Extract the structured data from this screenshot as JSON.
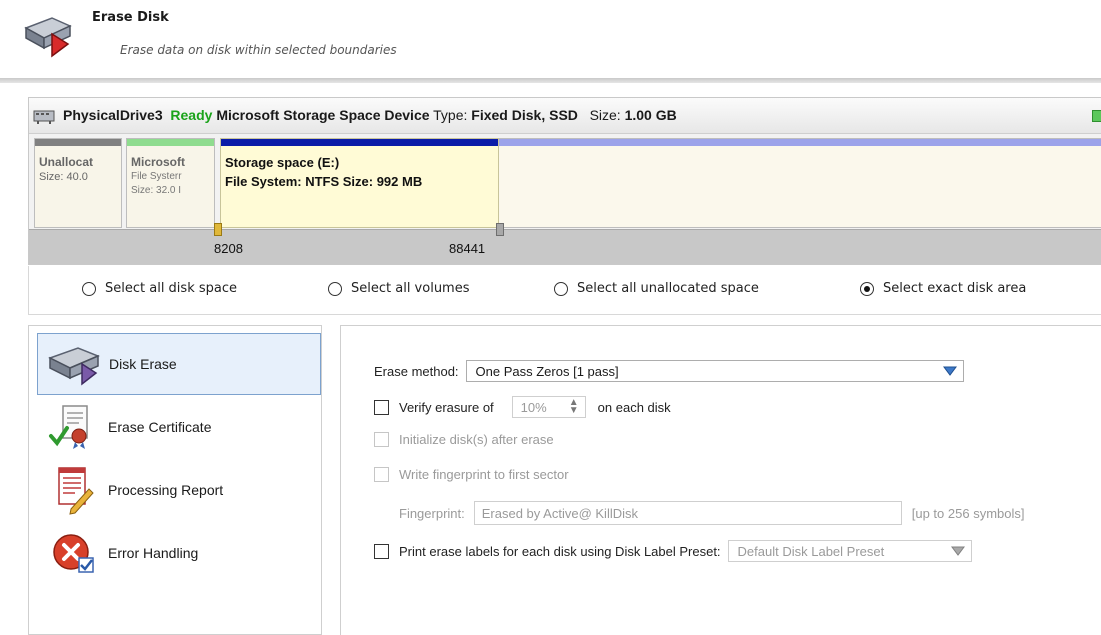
{
  "header": {
    "title": "Erase Disk",
    "subtitle": "Erase data on disk within selected boundaries",
    "icon": "disk-erase-icon"
  },
  "disk": {
    "name": "PhysicalDrive3",
    "status": "Ready",
    "device": "Microsoft Storage Space Device",
    "type_label": "Type:",
    "type_value": "Fixed Disk, SSD",
    "size_label": "Size:",
    "size_value": "1.00 GB",
    "status_color": "#1aa31a",
    "partitions": [
      {
        "name": "Unallocat",
        "line2": "Size: 40.0",
        "line3": "",
        "bar_color": "#808080"
      },
      {
        "name": "Microsoft",
        "line2": "File Systerr",
        "line3": "Size: 32.0 I",
        "bar_color": "#8fdc8f"
      },
      {
        "name": "Storage space (E:)",
        "line2": "File System: NTFS Size: 992 MB",
        "line3": "",
        "bar_color": "#0b1ca8"
      }
    ],
    "rest_bar_color": "#9ca3ea",
    "ruler": {
      "start": "8208",
      "end": "88441"
    }
  },
  "selection": {
    "options": [
      {
        "label": "Select all disk space",
        "selected": false
      },
      {
        "label": "Select all volumes",
        "selected": false
      },
      {
        "label": "Select all unallocated space",
        "selected": false
      },
      {
        "label": "Select exact disk area",
        "selected": true
      }
    ]
  },
  "nav": {
    "items": [
      {
        "label": "Disk Erase",
        "icon": "disk-erase-icon",
        "active": true
      },
      {
        "label": "Erase Certificate",
        "icon": "certificate-icon",
        "active": false
      },
      {
        "label": "Processing Report",
        "icon": "report-icon",
        "active": false
      },
      {
        "label": "Error Handling",
        "icon": "error-icon",
        "active": false
      }
    ]
  },
  "options": {
    "erase_method_label": "Erase method:",
    "erase_method_value": "One Pass Zeros [1 pass]",
    "verify_label": "Verify erasure of",
    "verify_value": "10%",
    "verify_suffix": "on each disk",
    "initialize_label": "Initialize disk(s) after erase",
    "fingerprint_write_label": "Write fingerprint to first sector",
    "fingerprint_label": "Fingerprint:",
    "fingerprint_value": "Erased by Active@ KillDisk",
    "fingerprint_hint": "[up to 256 symbols]",
    "print_labels_label": "Print erase labels for each disk using Disk Label Preset:",
    "preset_value": "Default Disk Label Preset",
    "accent_color": "#3c78c8"
  }
}
